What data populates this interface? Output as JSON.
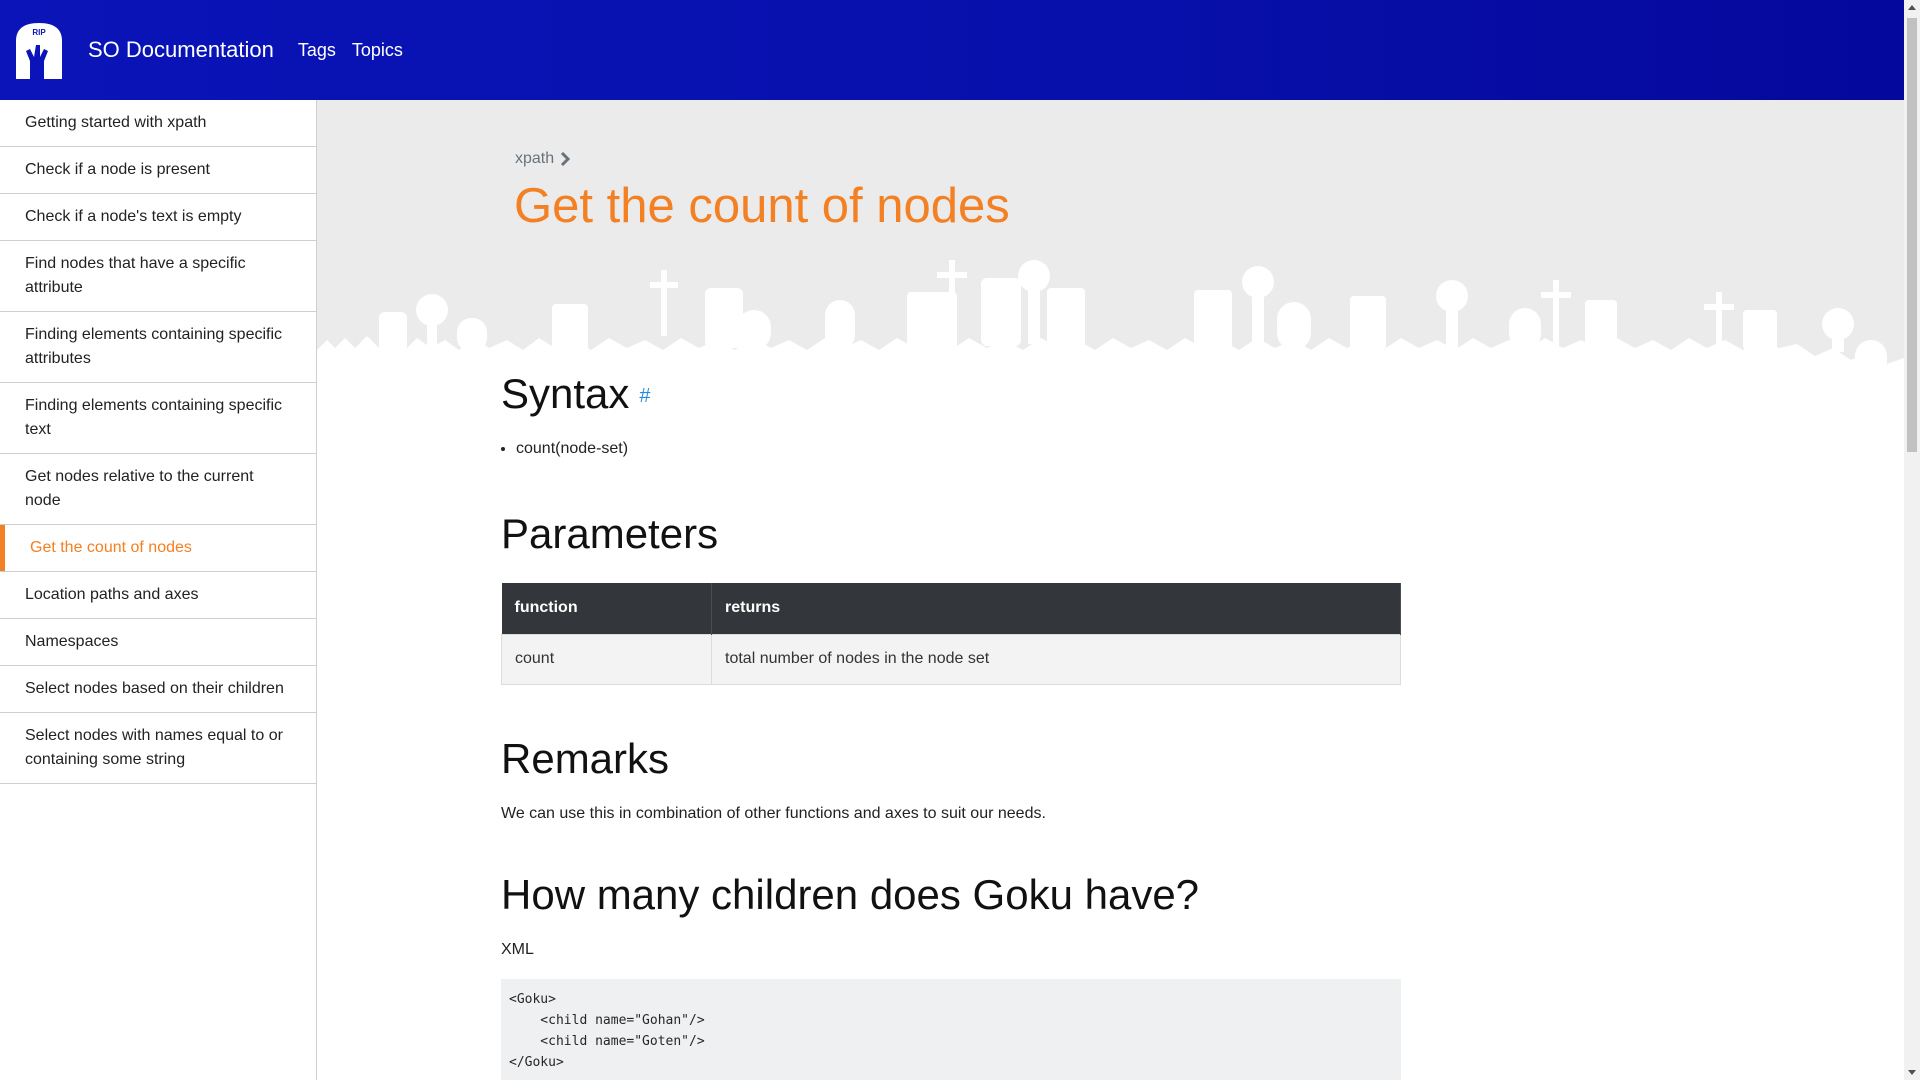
{
  "header": {
    "logo_text": "RIP",
    "brand": "SO Documentation",
    "nav": [
      {
        "label": "Tags"
      },
      {
        "label": "Topics"
      }
    ]
  },
  "sidebar": {
    "items": [
      {
        "label": "Getting started with xpath"
      },
      {
        "label": "Check if a node is present"
      },
      {
        "label": "Check if a node's text is empty"
      },
      {
        "label": "Find nodes that have a specific attribute"
      },
      {
        "label": "Finding elements containing specific attributes"
      },
      {
        "label": "Finding elements containing specific text"
      },
      {
        "label": "Get nodes relative to the current node"
      },
      {
        "label": "Get the count of nodes",
        "active": true
      },
      {
        "label": "Location paths and axes"
      },
      {
        "label": "Namespaces"
      },
      {
        "label": "Select nodes based on their children"
      },
      {
        "label": "Select nodes with names equal to or containing some string"
      }
    ]
  },
  "page": {
    "breadcrumb": "xpath",
    "title": "Get the count of nodes",
    "syntax": {
      "heading": "Syntax",
      "anchor": "#",
      "items": [
        "count(node-set)"
      ]
    },
    "parameters": {
      "heading": "Parameters",
      "headers": [
        "function",
        "returns"
      ],
      "rows": [
        [
          "count",
          "total number of nodes in the node set"
        ]
      ]
    },
    "remarks": {
      "heading": "Remarks",
      "text": "We can use this in combination of other functions and axes to suit our needs."
    },
    "example": {
      "heading": "How many children does Goku have?",
      "language_label": "XML",
      "code": "<Goku>\n    <child name=\"Gohan\"/>\n    <child name=\"Goten\"/>\n</Goku>"
    }
  },
  "colors": {
    "header_bg": "#0a14b8",
    "accent": "#f48024",
    "link": "#2b8cde",
    "table_header_bg": "#33363b",
    "hero_bg": "#ebebeb"
  }
}
